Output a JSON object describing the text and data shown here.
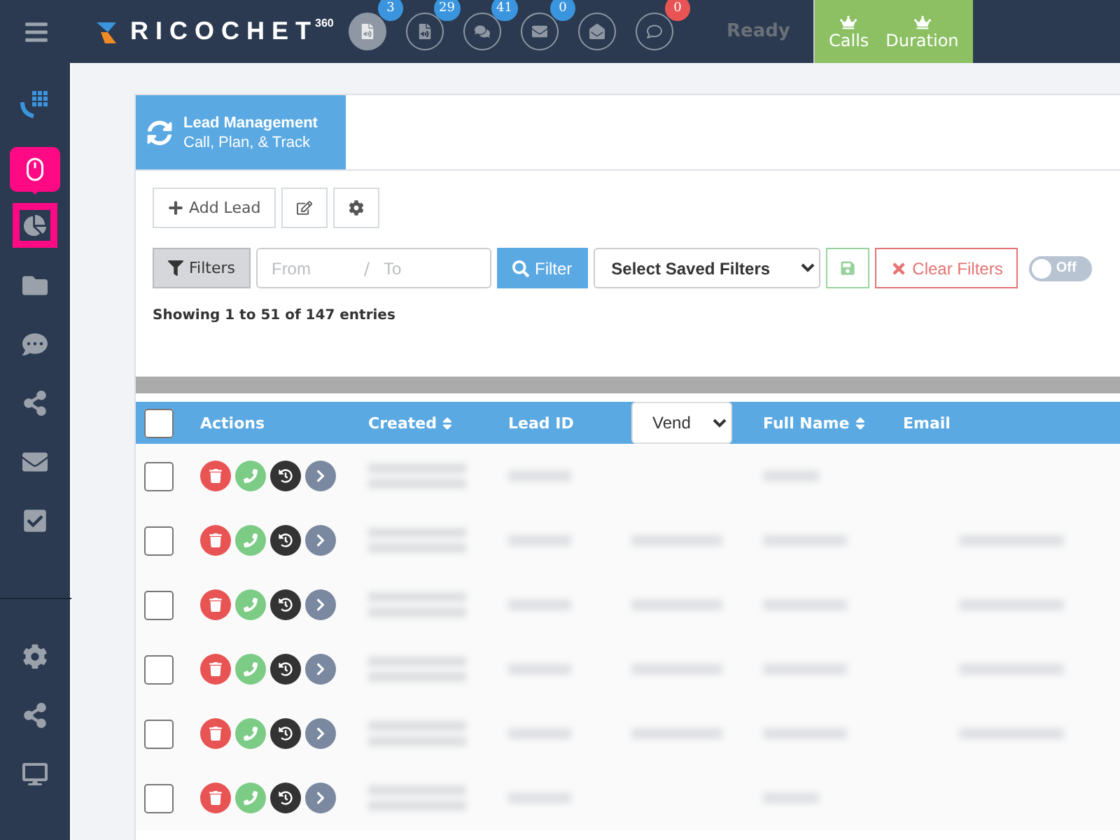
{
  "topbar": {
    "logo": {
      "text": "RICOCHET",
      "sup": "360"
    },
    "notifications": [
      {
        "kind": "voicemail",
        "active": true,
        "badge": "3",
        "color": "#3a95de"
      },
      {
        "kind": "voicemail",
        "active": false,
        "badge": "29",
        "color": "#3a95de"
      },
      {
        "kind": "chat",
        "active": false,
        "badge": "41",
        "color": "#3a95de"
      },
      {
        "kind": "mail",
        "active": false,
        "badge": "0",
        "color": "#3a95de"
      },
      {
        "kind": "open-mail",
        "active": false
      },
      {
        "kind": "comment",
        "active": false,
        "badge": "0",
        "color": "#e85454"
      }
    ],
    "status": "Ready",
    "stats": [
      "Calls",
      "Duration"
    ]
  },
  "sidebar": {
    "items": [
      {
        "kind": "dialpad",
        "selected": false
      },
      {
        "kind": "mouse",
        "selected": true,
        "tooltip": true
      },
      {
        "kind": "pie",
        "selected": true
      },
      {
        "kind": "contacts",
        "selected": false
      },
      {
        "kind": "chat",
        "selected": false
      },
      {
        "kind": "share",
        "selected": false
      },
      {
        "kind": "mail",
        "selected": false
      },
      {
        "kind": "tasks",
        "selected": false
      }
    ],
    "bottom_items": [
      {
        "kind": "settings",
        "selected": false
      },
      {
        "kind": "share",
        "selected": false
      },
      {
        "kind": "monitor",
        "selected": false
      }
    ]
  },
  "panel": {
    "title": "Lead Management",
    "subtitle": "Call, Plan, & Track",
    "add_button": "Add Lead",
    "filters_button": "Filters",
    "from_placeholder": "From",
    "separator": "/",
    "to_placeholder": "To",
    "filter_button": "Filter",
    "saved_filters": "Select Saved Filters",
    "clear_button": "Clear Filters",
    "toggle": {
      "on": false,
      "label": "Off"
    },
    "summary": "Showing 1 to 51 of 147 entries",
    "table": {
      "all_checked": false,
      "columns": [
        {
          "label": "Actions",
          "sortable": false
        },
        {
          "label": "Created",
          "sortable": true
        },
        {
          "label": "Lead ID",
          "sortable": false
        },
        {
          "label": "Vend",
          "kind": "select"
        },
        {
          "label": "Full Name",
          "sortable": true
        },
        {
          "label": "Email",
          "sortable": false
        }
      ],
      "rows": [
        {
          "checked": false,
          "kind": "short"
        },
        {
          "checked": false,
          "kind": "full"
        },
        {
          "checked": false,
          "kind": "full"
        },
        {
          "checked": false,
          "kind": "full"
        },
        {
          "checked": false,
          "kind": "full"
        },
        {
          "checked": false,
          "kind": "short"
        }
      ]
    }
  }
}
